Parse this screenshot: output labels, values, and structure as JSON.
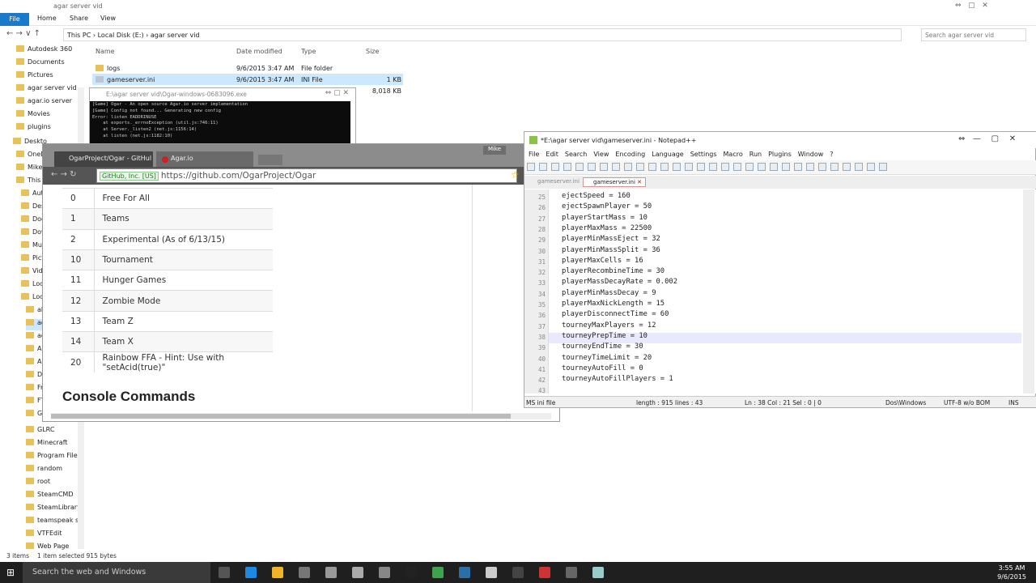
{
  "explorer": {
    "title": "agar server vid",
    "ribbon_tabs": [
      "File",
      "Home",
      "Share",
      "View"
    ],
    "path": [
      "This PC",
      "Local Disk (E:)",
      "agar server vid"
    ],
    "search_placeholder": "Search agar server vid",
    "nav_items": [
      "Autodesk 360",
      "Documents",
      "Pictures",
      "agar server vid",
      "agar.io server",
      "Movies",
      "plugins",
      "Deskto",
      "OneD",
      "Mike",
      "This",
      "Aut",
      "Des",
      "Doc",
      "Dow",
      "Mu",
      "Pict",
      "Vid",
      "Loc",
      "Loc",
      "ab",
      "ag",
      "ag",
      "An",
      "An",
      "Di",
      "Fr",
      "FT",
      "Gl",
      "GLRC",
      "Minecraft",
      "Program Files",
      "random",
      "root",
      "SteamCMD",
      "SteamLibrary",
      "teamspeak se",
      "VTFEdit",
      "Web Page"
    ],
    "columns": [
      "Name",
      "Date modified",
      "Type",
      "Size"
    ],
    "files": [
      {
        "name": "logs",
        "date": "9/6/2015 3:47 AM",
        "type": "File folder",
        "size": ""
      },
      {
        "name": "gameserver.ini",
        "date": "9/6/2015 3:47 AM",
        "type": "INI File",
        "size": "1 KB"
      },
      {
        "name": "",
        "date": "",
        "type": "",
        "size": "8,018 KB"
      }
    ],
    "status_items": "3 items",
    "status_selected": "1 item selected  915 bytes"
  },
  "console": {
    "title": "E:\\agar server vid\\Ogar-windows-0683096.exe",
    "lines": "[Game] Ogar - An open source Agar.io server implementation\n[Game] Config not found... Generating new config\nError: listen EADDRINUSE\n    at exports._errnoException (util.js:746:11)\n    at Server._listen2 (net.js:1156:14)\n    at listen (net.js:1182:10)"
  },
  "chrome": {
    "tab1": "OgarProject/Ogar - GitHul",
    "tab2": "Agar.io",
    "user": "Mike",
    "ev_badge": "GitHub, Inc. [US]",
    "url": "https://github.com/OgarProject/Ogar",
    "modes": [
      {
        "id": "0",
        "name": "Free For All"
      },
      {
        "id": "1",
        "name": "Teams"
      },
      {
        "id": "2",
        "name": "Experimental (As of 6/13/15)"
      },
      {
        "id": "10",
        "name": "Tournament"
      },
      {
        "id": "11",
        "name": "Hunger Games"
      },
      {
        "id": "12",
        "name": "Zombie Mode"
      },
      {
        "id": "13",
        "name": "Team Z"
      },
      {
        "id": "14",
        "name": "Team X"
      },
      {
        "id": "20",
        "name": "Rainbow FFA - Hint: Use with \"setAcid(true)\""
      }
    ],
    "heading": "Console Commands"
  },
  "notepad": {
    "title": "*E:\\agar server vid\\gameserver.ini - Notepad++",
    "menu": [
      "File",
      "Edit",
      "Search",
      "View",
      "Encoding",
      "Language",
      "Settings",
      "Macro",
      "Run",
      "Plugins",
      "Window",
      "?"
    ],
    "tabs": [
      "gameserver.ini",
      "gameserver.ini"
    ],
    "lines": [
      {
        "n": "25",
        "t": "ejectSpeed = 160"
      },
      {
        "n": "26",
        "t": "ejectSpawnPlayer = 50"
      },
      {
        "n": "27",
        "t": "playerStartMass = 10"
      },
      {
        "n": "28",
        "t": "playerMaxMass = 22500"
      },
      {
        "n": "29",
        "t": "playerMinMassEject = 32"
      },
      {
        "n": "30",
        "t": "playerMinMassSplit = 36"
      },
      {
        "n": "31",
        "t": "playerMaxCells = 16"
      },
      {
        "n": "32",
        "t": "playerRecombineTime = 30"
      },
      {
        "n": "33",
        "t": "playerMassDecayRate = 0.002"
      },
      {
        "n": "34",
        "t": "playerMinMassDecay = 9"
      },
      {
        "n": "35",
        "t": "playerMaxNickLength = 15"
      },
      {
        "n": "36",
        "t": "playerDisconnectTime = 60"
      },
      {
        "n": "37",
        "t": "tourneyMaxPlayers = 12"
      },
      {
        "n": "38",
        "t": "tourneyPrepTime = 10"
      },
      {
        "n": "39",
        "t": "tourneyEndTime = 30"
      },
      {
        "n": "40",
        "t": "tourneyTimeLimit = 20"
      },
      {
        "n": "41",
        "t": "tourneyAutoFill = 0"
      },
      {
        "n": "42",
        "t": "tourneyAutoFillPlayers = 1"
      },
      {
        "n": "43",
        "t": ""
      }
    ],
    "status": {
      "type": "MS ini file",
      "length": "length : 915",
      "lines": "lines : 43",
      "pos": "Ln : 38    Col : 21    Sel : 0 | 0",
      "eol": "Dos\\Windows",
      "enc": "UTF-8 w/o BOM",
      "mode": "INS"
    }
  },
  "taskbar": {
    "search": "Search the web and Windows",
    "time": "3:55 AM",
    "date": "9/6/2015"
  },
  "colors": {
    "accent": "#1979ca",
    "taskbar": "#1f1f1f"
  }
}
